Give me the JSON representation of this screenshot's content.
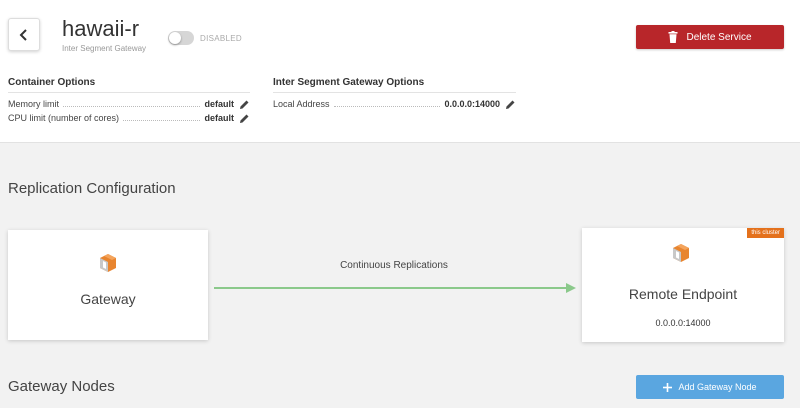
{
  "header": {
    "title": "hawaii-r",
    "subtitle": "Inter Segment Gateway",
    "toggle_label": "DISABLED",
    "delete_label": "Delete Service"
  },
  "container_options": {
    "title": "Container Options",
    "rows": [
      {
        "label": "Memory limit",
        "value": "default"
      },
      {
        "label": "CPU limit (number of cores)",
        "value": "default"
      }
    ]
  },
  "gateway_options": {
    "title": "Inter Segment Gateway Options",
    "rows": [
      {
        "label": "Local Address",
        "value": "0.0.0.0:14000"
      }
    ]
  },
  "replication": {
    "title": "Replication Configuration",
    "source_label": "Gateway",
    "link_label": "Continuous Replications",
    "target_label": "Remote Endpoint",
    "target_address": "0.0.0.0:14000",
    "target_badge": "this cluster"
  },
  "nodes": {
    "title": "Gateway Nodes",
    "add_label": "Add Gateway Node"
  },
  "colors": {
    "delete": "#b8262a",
    "add": "#5aa6e0",
    "link": "#8bc98b",
    "badge": "#e4711c",
    "logo_orange": "#e8852f"
  }
}
